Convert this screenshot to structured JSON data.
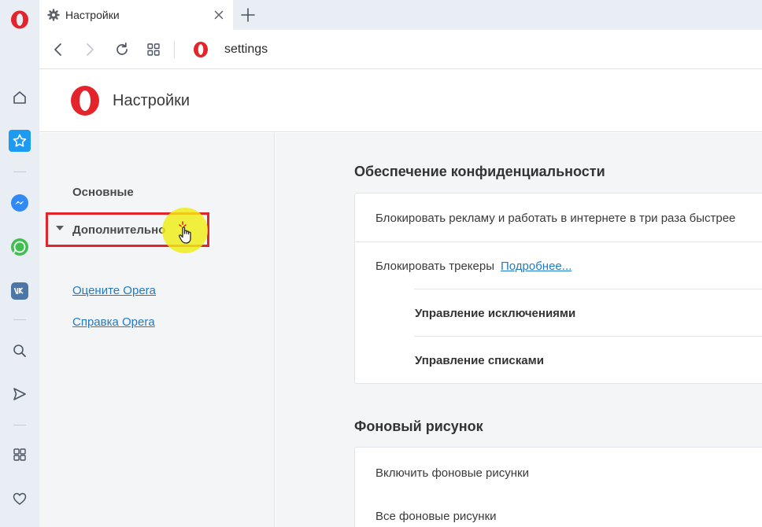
{
  "browser": {
    "tab": {
      "title": "Настройки"
    },
    "address_bar": {
      "url": "settings"
    }
  },
  "sidebar_icons": [
    "home-icon",
    "speed-dial-icon",
    "messenger-icon",
    "whatsapp-icon",
    "vk-icon",
    "search-icon",
    "send-icon",
    "apps-icon",
    "heart-icon"
  ],
  "page": {
    "title": "Настройки"
  },
  "nav": {
    "basic": "Основные",
    "advanced": "Дополнительно",
    "rate_opera": "Оцените Opera",
    "help_opera": "Справка Opera"
  },
  "privacy": {
    "title": "Обеспечение конфиденциальности",
    "block_ads": "Блокировать рекламу и работать в интернете в три раза быстрее",
    "block_trackers": "Блокировать трекеры",
    "learn_more": "Подробнее...",
    "manage_exceptions": "Управление исключениями",
    "manage_lists": "Управление списками"
  },
  "wallpapers": {
    "title": "Фоновый рисунок",
    "enable": "Включить фоновые рисунки",
    "all": "Все фоновые рисунки"
  },
  "colors": {
    "opera_red": "#e3252b",
    "accent_blue": "#1d9bf0",
    "link_blue": "#1f7ac9",
    "messenger_blue": "#2f8af5",
    "whatsapp_green": "#3fbf4f",
    "vk_blue": "#4a76a8"
  }
}
